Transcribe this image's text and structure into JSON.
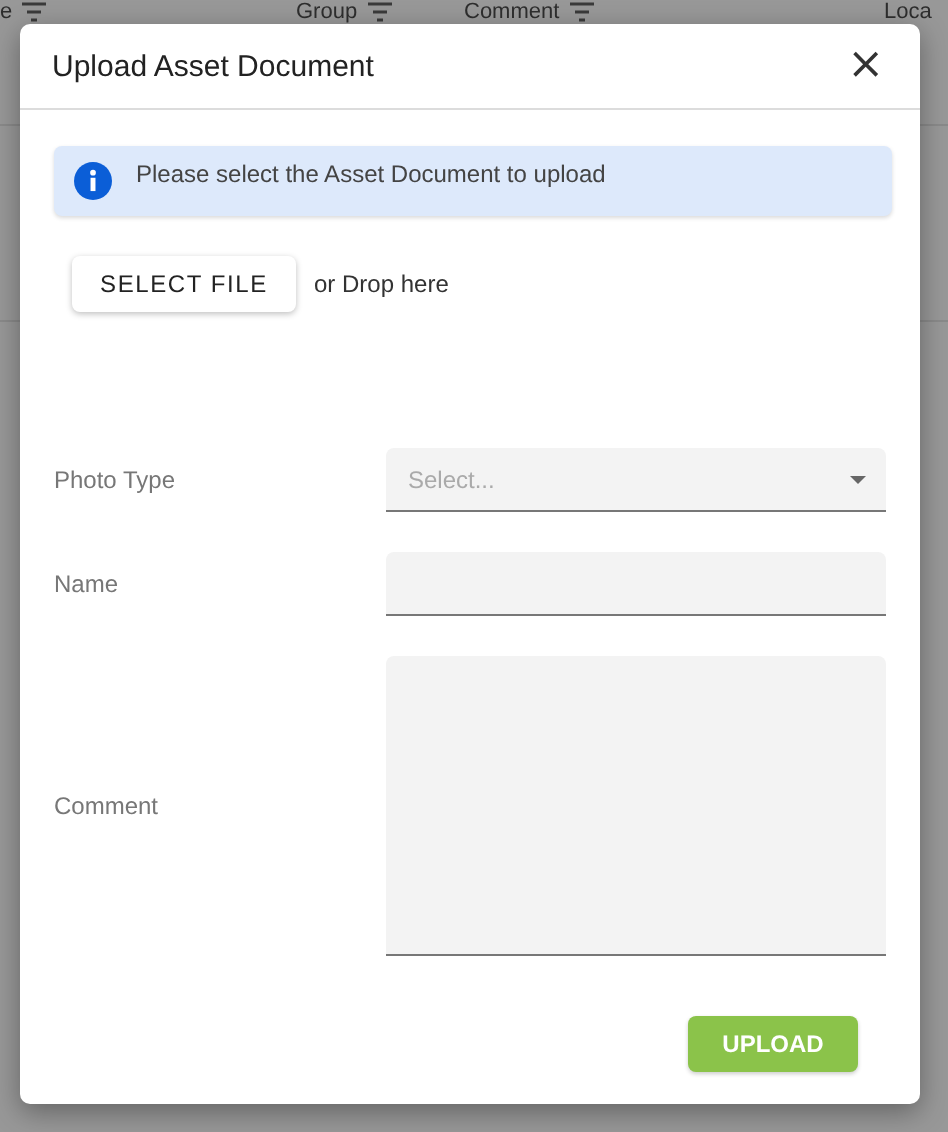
{
  "background_table": {
    "columns": [
      "e",
      "Group",
      "Comment",
      "Loca"
    ]
  },
  "dialog": {
    "title": "Upload Asset Document",
    "close": "×",
    "info": "Please select the Asset Document to upload",
    "select_file_button": "SELECT FILE",
    "drop_hint": "or Drop here",
    "fields": [
      {
        "label": "Photo Type",
        "kind": "select",
        "placeholder": "Select..."
      },
      {
        "label": "Name",
        "kind": "text"
      },
      {
        "label": "Comment",
        "kind": "textarea"
      }
    ],
    "upload_button": "UPLOAD"
  }
}
